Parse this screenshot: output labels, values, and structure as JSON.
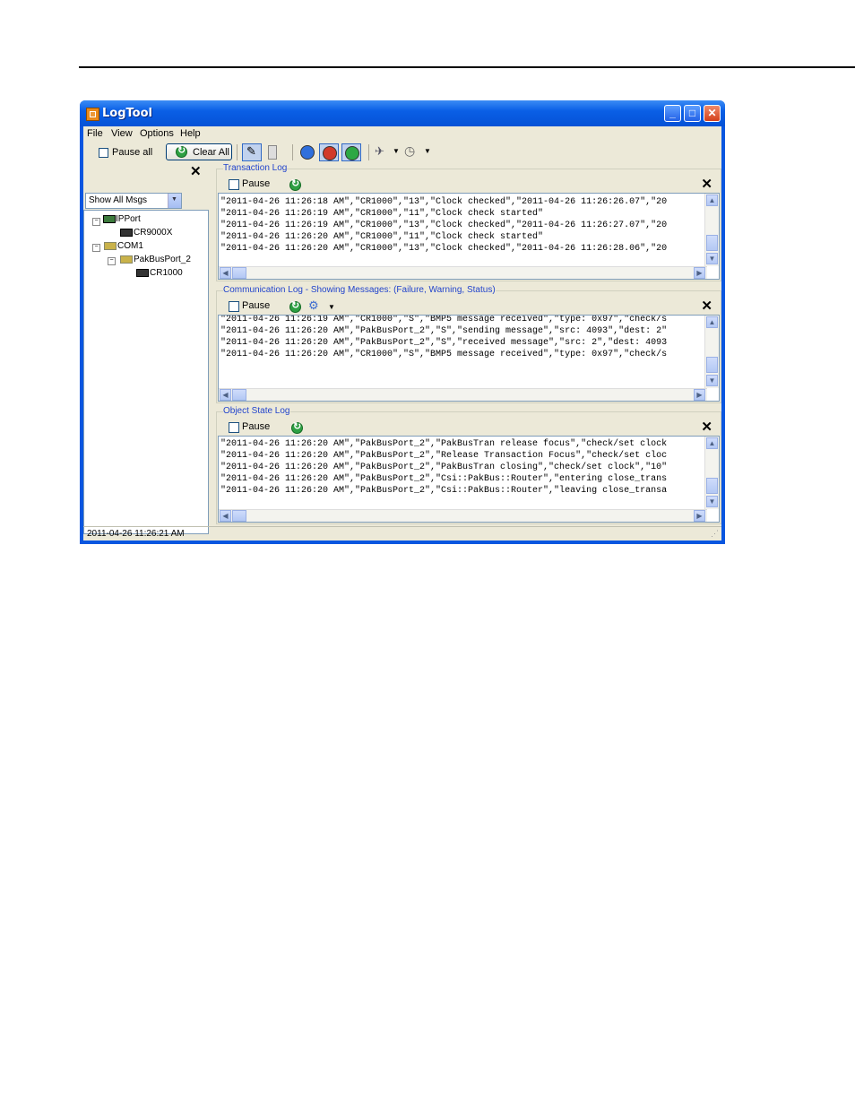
{
  "window": {
    "title": "LogTool"
  },
  "menu": [
    "File",
    "View",
    "Options",
    "Help"
  ],
  "toolbar": {
    "pause_all": "Pause all",
    "clear_all": "Clear All"
  },
  "left_panel": {
    "close": "✕",
    "filter_value": "Show All Msgs",
    "tree": [
      {
        "label": "IPPort",
        "level": 0
      },
      {
        "label": "CR9000X",
        "level": 1
      },
      {
        "label": "COM1",
        "level": 0
      },
      {
        "label": "PakBusPort_2",
        "level": 1
      },
      {
        "label": "CR1000",
        "level": 2
      }
    ]
  },
  "transaction_log": {
    "title": "Transaction Log",
    "pause": "Pause",
    "close": "✕",
    "lines": [
      "\"2011-04-26 11:26:18 AM\",\"CR1000\",\"13\",\"Clock checked\",\"2011-04-26 11:26:26.07\",\"20",
      "\"2011-04-26 11:26:19 AM\",\"CR1000\",\"11\",\"Clock check started\"",
      "\"2011-04-26 11:26:19 AM\",\"CR1000\",\"13\",\"Clock checked\",\"2011-04-26 11:26:27.07\",\"20",
      "\"2011-04-26 11:26:20 AM\",\"CR1000\",\"11\",\"Clock check started\"",
      "\"2011-04-26 11:26:20 AM\",\"CR1000\",\"13\",\"Clock checked\",\"2011-04-26 11:26:28.06\",\"20"
    ]
  },
  "communication_log": {
    "title": "Communication Log - Showing Messages: (Failure, Warning, Status)",
    "pause": "Pause",
    "close": "✕",
    "lines": [
      "\"2011-04-26 11:26:19 AM\",\"CR1000\",\"S\",\"BMP5 message received\",\"type: 0x97\",\"check/s",
      "\"2011-04-26 11:26:20 AM\",\"PakBusPort_2\",\"S\",\"sending message\",\"src: 4093\",\"dest: 2\"",
      "\"2011-04-26 11:26:20 AM\",\"PakBusPort_2\",\"S\",\"received message\",\"src: 2\",\"dest: 4093",
      "\"2011-04-26 11:26:20 AM\",\"CR1000\",\"S\",\"BMP5 message received\",\"type: 0x97\",\"check/s"
    ]
  },
  "object_state_log": {
    "title": "Object State Log",
    "pause": "Pause",
    "close": "✕",
    "lines": [
      "\"2011-04-26 11:26:20 AM\",\"PakBusPort_2\",\"PakBusTran release focus\",\"check/set clock",
      "\"2011-04-26 11:26:20 AM\",\"PakBusPort_2\",\"Release Transaction Focus\",\"check/set cloc",
      "\"2011-04-26 11:26:20 AM\",\"PakBusPort_2\",\"PakBusTran closing\",\"check/set clock\",\"10\"",
      "\"2011-04-26 11:26:20 AM\",\"PakBusPort_2\",\"Csi::PakBus::Router\",\"entering close_trans",
      "\"2011-04-26 11:26:20 AM\",\"PakBusPort_2\",\"Csi::PakBus::Router\",\"leaving close_transa"
    ]
  },
  "status_bar": {
    "text": "2011-04-26 11:26:21 AM"
  }
}
